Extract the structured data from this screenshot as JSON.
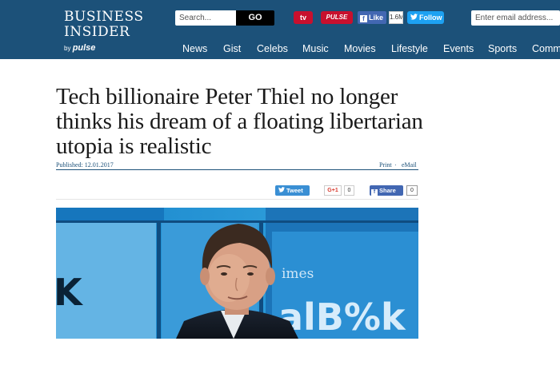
{
  "header": {
    "logo": {
      "line1": "BUSINESS",
      "line2": "INSIDER",
      "by": "by",
      "partner": "pulse"
    },
    "search": {
      "placeholder": "Search...",
      "button_label": "GO"
    },
    "tv_label": "tv",
    "red_badge_label": "PULSE",
    "facebook": {
      "like_label": "Like",
      "like_count": "1.6M"
    },
    "twitter": {
      "follow_label": "Follow"
    },
    "email": {
      "placeholder": "Enter email address..."
    },
    "nav": [
      "News",
      "Gist",
      "Celebs",
      "Music",
      "Movies",
      "Lifestyle",
      "Events",
      "Sports",
      "Comm"
    ]
  },
  "article": {
    "headline": "Tech billionaire Peter Thiel no longer thinks his dream of a floating libertarian utopia is realistic",
    "published": "Published: 12.01.2017",
    "print_label": "Print",
    "separator": "·",
    "email_label": "eMail",
    "share": {
      "tweet_label": "Tweet",
      "gplus_label": "G+1",
      "gplus_count": "0",
      "fb_share_label": "Share",
      "fb_share_count": "0"
    },
    "hero_image": {
      "background_text_1": "K",
      "background_text_2": "imes",
      "background_text_3": "alB%k"
    }
  },
  "colors": {
    "header_bg": "#1c5179",
    "accent_red": "#c8102e",
    "facebook_blue": "#4267b2",
    "twitter_blue": "#1da1f2"
  },
  "icons": [
    "facebook-icon",
    "twitter-bird-icon",
    "google-plus-icon"
  ]
}
